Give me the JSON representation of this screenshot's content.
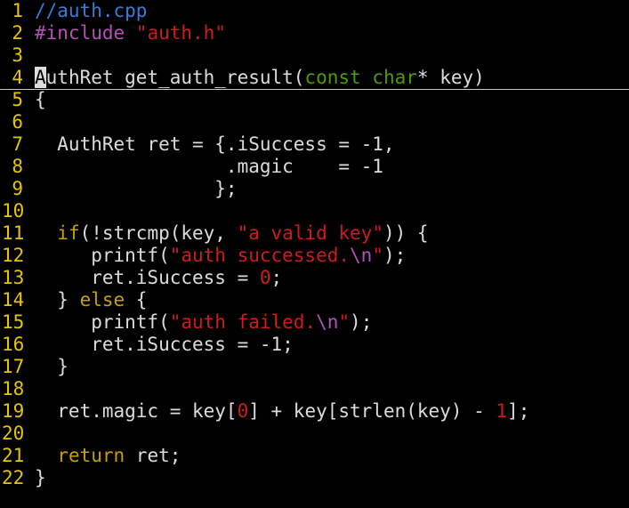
{
  "editor": {
    "lines": [
      {
        "number": "1",
        "tokens": [
          {
            "text": "//auth.cpp",
            "kind": "comment"
          }
        ]
      },
      {
        "number": "2",
        "tokens": [
          {
            "text": "#include ",
            "kind": "preproc"
          },
          {
            "text": "\"auth.h\"",
            "kind": "string"
          }
        ]
      },
      {
        "number": "3",
        "tokens": []
      },
      {
        "number": "4",
        "cursor_line": true,
        "tokens": [
          {
            "text": "A",
            "kind": "cursor"
          },
          {
            "text": "uthRet get_auth_result(",
            "kind": "default"
          },
          {
            "text": "const",
            "kind": "type"
          },
          {
            "text": " ",
            "kind": "default"
          },
          {
            "text": "char",
            "kind": "type"
          },
          {
            "text": "* key)",
            "kind": "default"
          }
        ]
      },
      {
        "number": "5",
        "tokens": [
          {
            "text": "{",
            "kind": "default"
          }
        ]
      },
      {
        "number": "6",
        "tokens": []
      },
      {
        "number": "7",
        "tokens": [
          {
            "text": "  AuthRet ret = {.iSuccess = -1,",
            "kind": "default"
          }
        ]
      },
      {
        "number": "8",
        "tokens": [
          {
            "text": "                 .magic    = -1",
            "kind": "default"
          }
        ]
      },
      {
        "number": "9",
        "tokens": [
          {
            "text": "                };",
            "kind": "default"
          }
        ]
      },
      {
        "number": "10",
        "tokens": []
      },
      {
        "number": "11",
        "tokens": [
          {
            "text": "  ",
            "kind": "default"
          },
          {
            "text": "if",
            "kind": "keyword"
          },
          {
            "text": "(!strcmp(key, ",
            "kind": "default"
          },
          {
            "text": "\"a valid key\"",
            "kind": "string"
          },
          {
            "text": ")) {",
            "kind": "default"
          }
        ]
      },
      {
        "number": "12",
        "tokens": [
          {
            "text": "     printf(",
            "kind": "default"
          },
          {
            "text": "\"auth successed.",
            "kind": "string"
          },
          {
            "text": "\\n",
            "kind": "special"
          },
          {
            "text": "\"",
            "kind": "string"
          },
          {
            "text": ");",
            "kind": "default"
          }
        ]
      },
      {
        "number": "13",
        "tokens": [
          {
            "text": "     ret.iSuccess = ",
            "kind": "default"
          },
          {
            "text": "0",
            "kind": "number"
          },
          {
            "text": ";",
            "kind": "default"
          }
        ]
      },
      {
        "number": "14",
        "tokens": [
          {
            "text": "  } ",
            "kind": "default"
          },
          {
            "text": "else",
            "kind": "keyword"
          },
          {
            "text": " {",
            "kind": "default"
          }
        ]
      },
      {
        "number": "15",
        "tokens": [
          {
            "text": "     printf(",
            "kind": "default"
          },
          {
            "text": "\"auth failed.",
            "kind": "string"
          },
          {
            "text": "\\n",
            "kind": "special"
          },
          {
            "text": "\"",
            "kind": "string"
          },
          {
            "text": ");",
            "kind": "default"
          }
        ]
      },
      {
        "number": "16",
        "tokens": [
          {
            "text": "     ret.iSuccess = -1;",
            "kind": "default"
          }
        ]
      },
      {
        "number": "17",
        "tokens": [
          {
            "text": "  }",
            "kind": "default"
          }
        ]
      },
      {
        "number": "18",
        "tokens": []
      },
      {
        "number": "19",
        "tokens": [
          {
            "text": "  ret.magic = key[",
            "kind": "default"
          },
          {
            "text": "0",
            "kind": "number"
          },
          {
            "text": "] + key[strlen(key) - ",
            "kind": "default"
          },
          {
            "text": "1",
            "kind": "number"
          },
          {
            "text": "];",
            "kind": "default"
          }
        ]
      },
      {
        "number": "20",
        "tokens": []
      },
      {
        "number": "21",
        "tokens": [
          {
            "text": "  ",
            "kind": "default"
          },
          {
            "text": "return",
            "kind": "keyword"
          },
          {
            "text": " ret;",
            "kind": "default"
          }
        ]
      },
      {
        "number": "22",
        "tokens": [
          {
            "text": "}",
            "kind": "default"
          }
        ]
      }
    ]
  },
  "colors": {
    "background": "#000000",
    "line_number": "#e5c400",
    "default_text": "#dcdcdc",
    "comment": "#3a7bd5",
    "preproc": "#b64fb6",
    "string": "#d01a1a",
    "keyword": "#c7a000",
    "type": "#4e9a06"
  }
}
